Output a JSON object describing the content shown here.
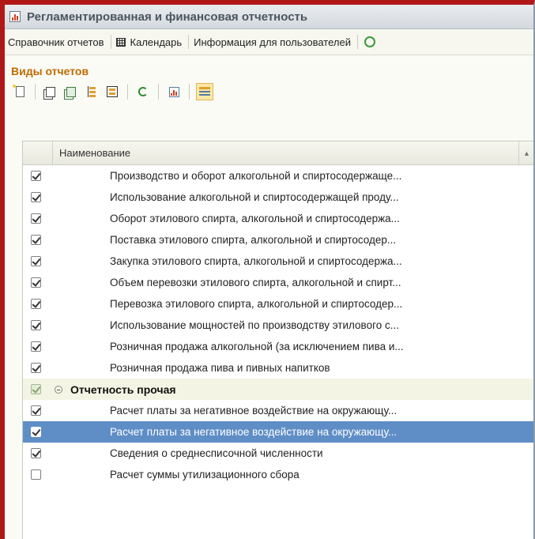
{
  "window": {
    "title": "Регламентированная и финансовая отчетность"
  },
  "commandbar": {
    "items": [
      {
        "label": "Справочник отчетов"
      },
      {
        "label": "Календарь",
        "icon": "calendar-icon"
      },
      {
        "label": "Информация для пользователей"
      }
    ]
  },
  "section": {
    "title": "Виды отчетов"
  },
  "toolbar": {
    "icons": [
      "new-icon",
      "copy-icon",
      "edit-icon",
      "tree-hierarchy-icon",
      "tree-list-icon",
      "refresh-icon",
      "chart-icon",
      "list-mode-icon"
    ]
  },
  "table": {
    "header": {
      "name": "Наименование",
      "sort_icon": "sort-up-icon"
    },
    "rows": [
      {
        "type": "item",
        "checked": true,
        "name": "Производство и оборот алкогольной и спиртосодержаще..."
      },
      {
        "type": "item",
        "checked": true,
        "name": "Использование алкогольной и спиртосодержащей проду..."
      },
      {
        "type": "item",
        "checked": true,
        "name": "Оборот этилового спирта, алкогольной и спиртосодержа..."
      },
      {
        "type": "item",
        "checked": true,
        "name": "Поставка этилового спирта, алкогольной и спиртосодер..."
      },
      {
        "type": "item",
        "checked": true,
        "name": "Закупка этилового спирта, алкогольной и спиртосодержа..."
      },
      {
        "type": "item",
        "checked": true,
        "name": "Объем перевозки этилового спирта, алкогольной и спирт..."
      },
      {
        "type": "item",
        "checked": true,
        "name": "Перевозка этилового спирта, алкогольной и спиртосодер..."
      },
      {
        "type": "item",
        "checked": true,
        "name": "Использование мощностей по производству этилового с..."
      },
      {
        "type": "item",
        "checked": true,
        "name": "Розничная продажа алкогольной (за исключением пива и..."
      },
      {
        "type": "item",
        "checked": true,
        "name": "Розничная продажа пива и пивных напитков"
      },
      {
        "type": "group",
        "checked": true,
        "name": "Отчетность прочая"
      },
      {
        "type": "item",
        "checked": true,
        "name": "Расчет платы за негативное воздействие на окружающу..."
      },
      {
        "type": "item",
        "checked": true,
        "selected": true,
        "name": "Расчет платы за негативное воздействие на окружающу..."
      },
      {
        "type": "item",
        "checked": true,
        "name": "Сведения о среднесписочной численности"
      },
      {
        "type": "item",
        "checked": false,
        "name": "Расчет суммы утилизационного сбора"
      }
    ]
  },
  "colors": {
    "frame_border": "#b01818",
    "section_title": "#c06a00",
    "selection": "#5f8ec6",
    "group_row": "#f4f4e4"
  }
}
